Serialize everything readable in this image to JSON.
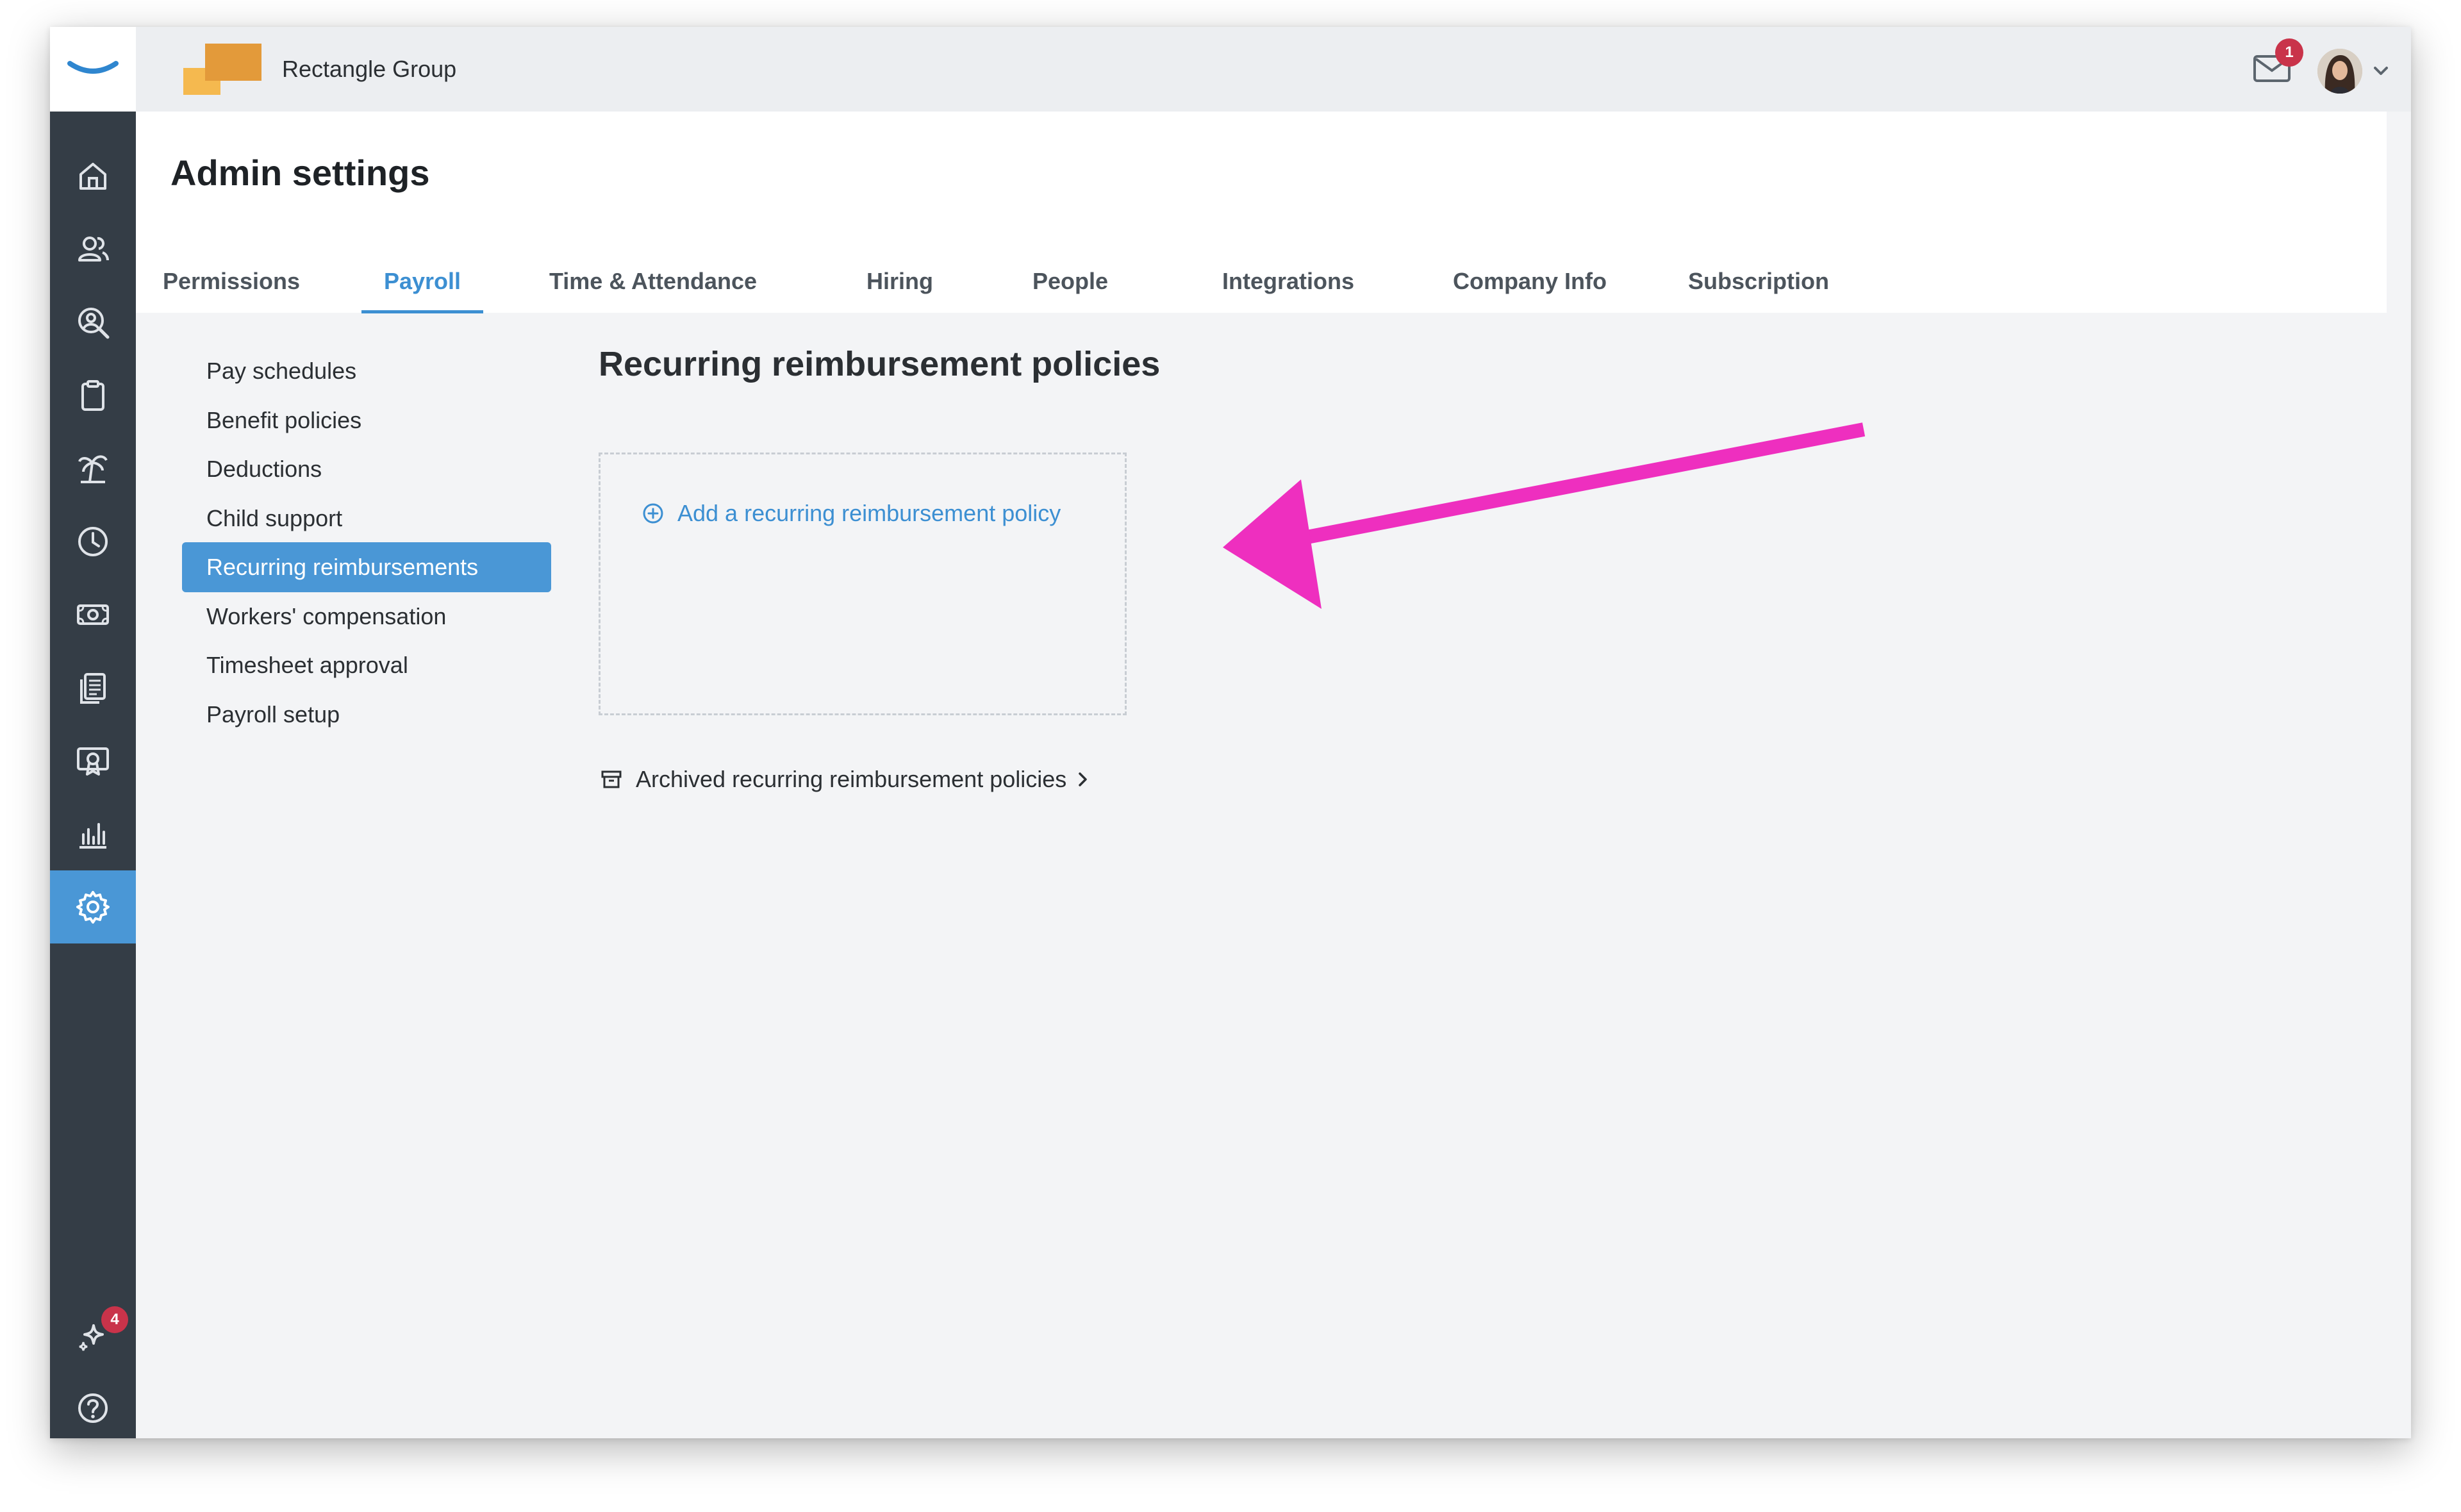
{
  "topbar": {
    "company_name": "Rectangle Group",
    "mail_badge": "1"
  },
  "sidebar": {
    "items": [
      {
        "icon": "home-icon"
      },
      {
        "icon": "people-icon"
      },
      {
        "icon": "search-person-icon"
      },
      {
        "icon": "clipboard-icon"
      },
      {
        "icon": "palm-tree-icon"
      },
      {
        "icon": "clock-icon"
      },
      {
        "icon": "money-icon"
      },
      {
        "icon": "documents-icon"
      },
      {
        "icon": "certificate-icon"
      },
      {
        "icon": "bar-chart-icon"
      },
      {
        "icon": "gear-icon",
        "active": true
      }
    ],
    "bottom": [
      {
        "icon": "sparkle-icon",
        "badge": "4"
      },
      {
        "icon": "help-icon"
      }
    ]
  },
  "header": {
    "title": "Admin settings",
    "tabs": [
      {
        "label": "Permissions"
      },
      {
        "label": "Payroll",
        "active": true
      },
      {
        "label": "Time & Attendance"
      },
      {
        "label": "Hiring"
      },
      {
        "label": "People"
      },
      {
        "label": "Integrations"
      },
      {
        "label": "Company Info"
      },
      {
        "label": "Subscription"
      }
    ]
  },
  "subnav": {
    "items": [
      {
        "label": "Pay schedules"
      },
      {
        "label": "Benefit policies"
      },
      {
        "label": "Deductions"
      },
      {
        "label": "Child support"
      },
      {
        "label": "Recurring reimbursements",
        "active": true
      },
      {
        "label": "Workers' compensation"
      },
      {
        "label": "Timesheet approval"
      },
      {
        "label": "Payroll setup"
      }
    ]
  },
  "main": {
    "title": "Recurring reimbursement policies",
    "add_link": "Add a recurring reimbursement policy",
    "archived_link": "Archived recurring reimbursement policies"
  },
  "colors": {
    "accent": "#4a97d6",
    "sidebar": "#343d46",
    "badge": "#c9334a",
    "annotation_arrow": "#ee2fbf"
  }
}
